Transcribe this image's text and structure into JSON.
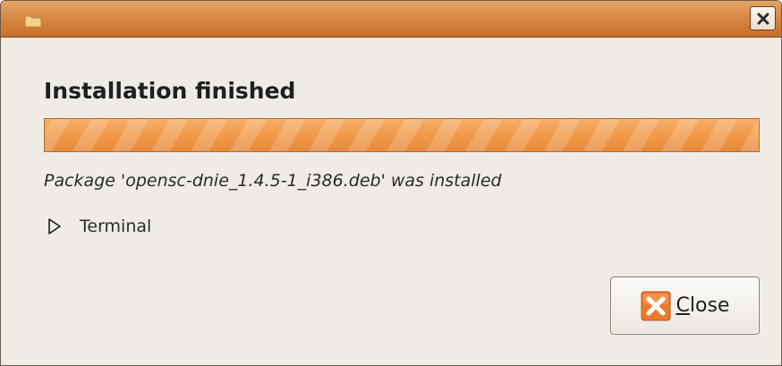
{
  "window": {
    "app_icon": "folder-icon",
    "close_icon": "close-icon"
  },
  "dialog": {
    "heading": "Installation finished",
    "progress": {
      "fraction": 1.0
    },
    "status": "Package 'opensc-dnie_1.4.5-1_i386.deb' was installed",
    "expander": {
      "label": "Terminal",
      "expanded": false,
      "icon": "expander-arrow-icon"
    },
    "close_button": {
      "label_mnemonic": "C",
      "label_rest": "lose",
      "icon": "close-icon"
    }
  },
  "colors": {
    "titlebar": "#d88a44",
    "progress_fill": "#f09a4a",
    "background": "#efebe7"
  }
}
